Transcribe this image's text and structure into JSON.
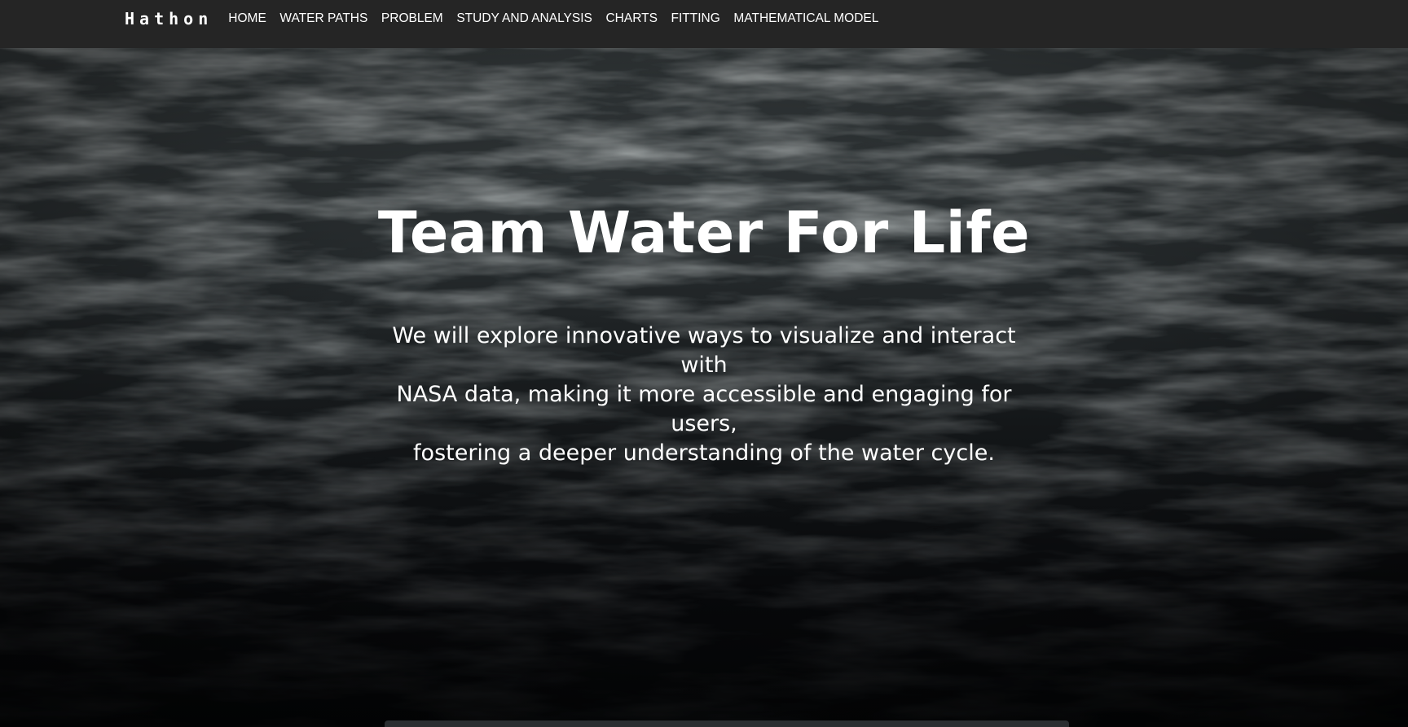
{
  "navbar": {
    "brand": "Hathon",
    "links": [
      {
        "label": "HOME"
      },
      {
        "label": "WATER PATHS"
      },
      {
        "label": "PROBLEM"
      },
      {
        "label": "STUDY AND ANALYSIS"
      },
      {
        "label": "CHARTS"
      },
      {
        "label": "FITTING"
      },
      {
        "label": "MATHEMATICAL MODEL"
      }
    ]
  },
  "hero": {
    "title": "Team Water For Life",
    "subtitle_lines": [
      "We will explore innovative ways to visualize and interact with",
      "NASA data, making it more accessible and engaging for users,",
      "fostering a deeper understanding of the water cycle."
    ],
    "background": "ocean-waves-image"
  },
  "colors": {
    "navbar_bg": "#252525",
    "text": "#ffffff",
    "water_dark": "#050607"
  }
}
